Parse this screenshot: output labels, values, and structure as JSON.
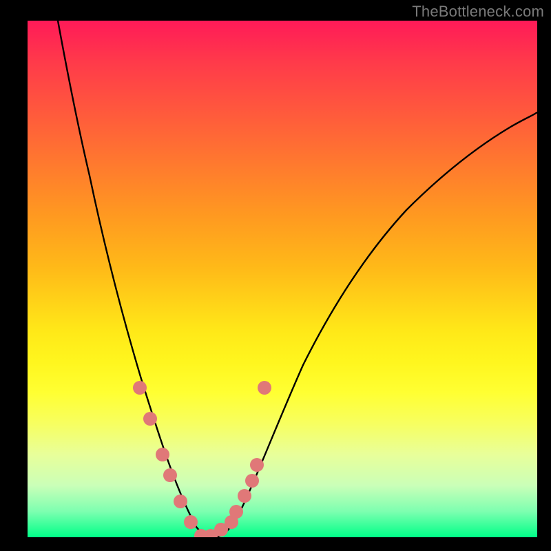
{
  "watermark": "TheBottleneck.com",
  "chart_data": {
    "type": "line",
    "title": "",
    "xlabel": "",
    "ylabel": "",
    "xlim": [
      0,
      100
    ],
    "ylim": [
      0,
      100
    ],
    "gradient_background": {
      "top_color": "#ff1a58",
      "mid_colors": [
        "#ff7a2e",
        "#ffd118",
        "#fff61e"
      ],
      "bottom_color": "#00ff88"
    },
    "series": [
      {
        "name": "bottleneck-curve",
        "color": "#000000",
        "x": [
          6,
          8,
          10,
          12,
          14,
          16,
          18,
          20,
          22,
          24,
          26,
          28,
          30,
          32,
          34,
          36,
          40,
          45,
          50,
          55,
          60,
          65,
          70,
          75,
          80,
          85,
          90,
          95,
          100
        ],
        "y": [
          100,
          90,
          80,
          70,
          60,
          51,
          43,
          36,
          29,
          23,
          17,
          12,
          7,
          3,
          0,
          0,
          3,
          10,
          19,
          28,
          36,
          43,
          50,
          56,
          61,
          66,
          70,
          74,
          77
        ]
      }
    ],
    "markers": [
      {
        "name": "left-branch-points",
        "color": "#e07878",
        "radius_px": 10,
        "x": [
          22,
          24,
          26.5,
          28,
          30,
          32,
          34
        ],
        "y": [
          29,
          23,
          16,
          12,
          7,
          3,
          0
        ]
      },
      {
        "name": "right-branch-points",
        "color": "#e07878",
        "radius_px": 10,
        "x": [
          36,
          38,
          40,
          41,
          42.5,
          44,
          45,
          46.5
        ],
        "y": [
          0,
          1.5,
          3,
          5,
          8,
          11,
          14,
          29
        ]
      }
    ]
  }
}
